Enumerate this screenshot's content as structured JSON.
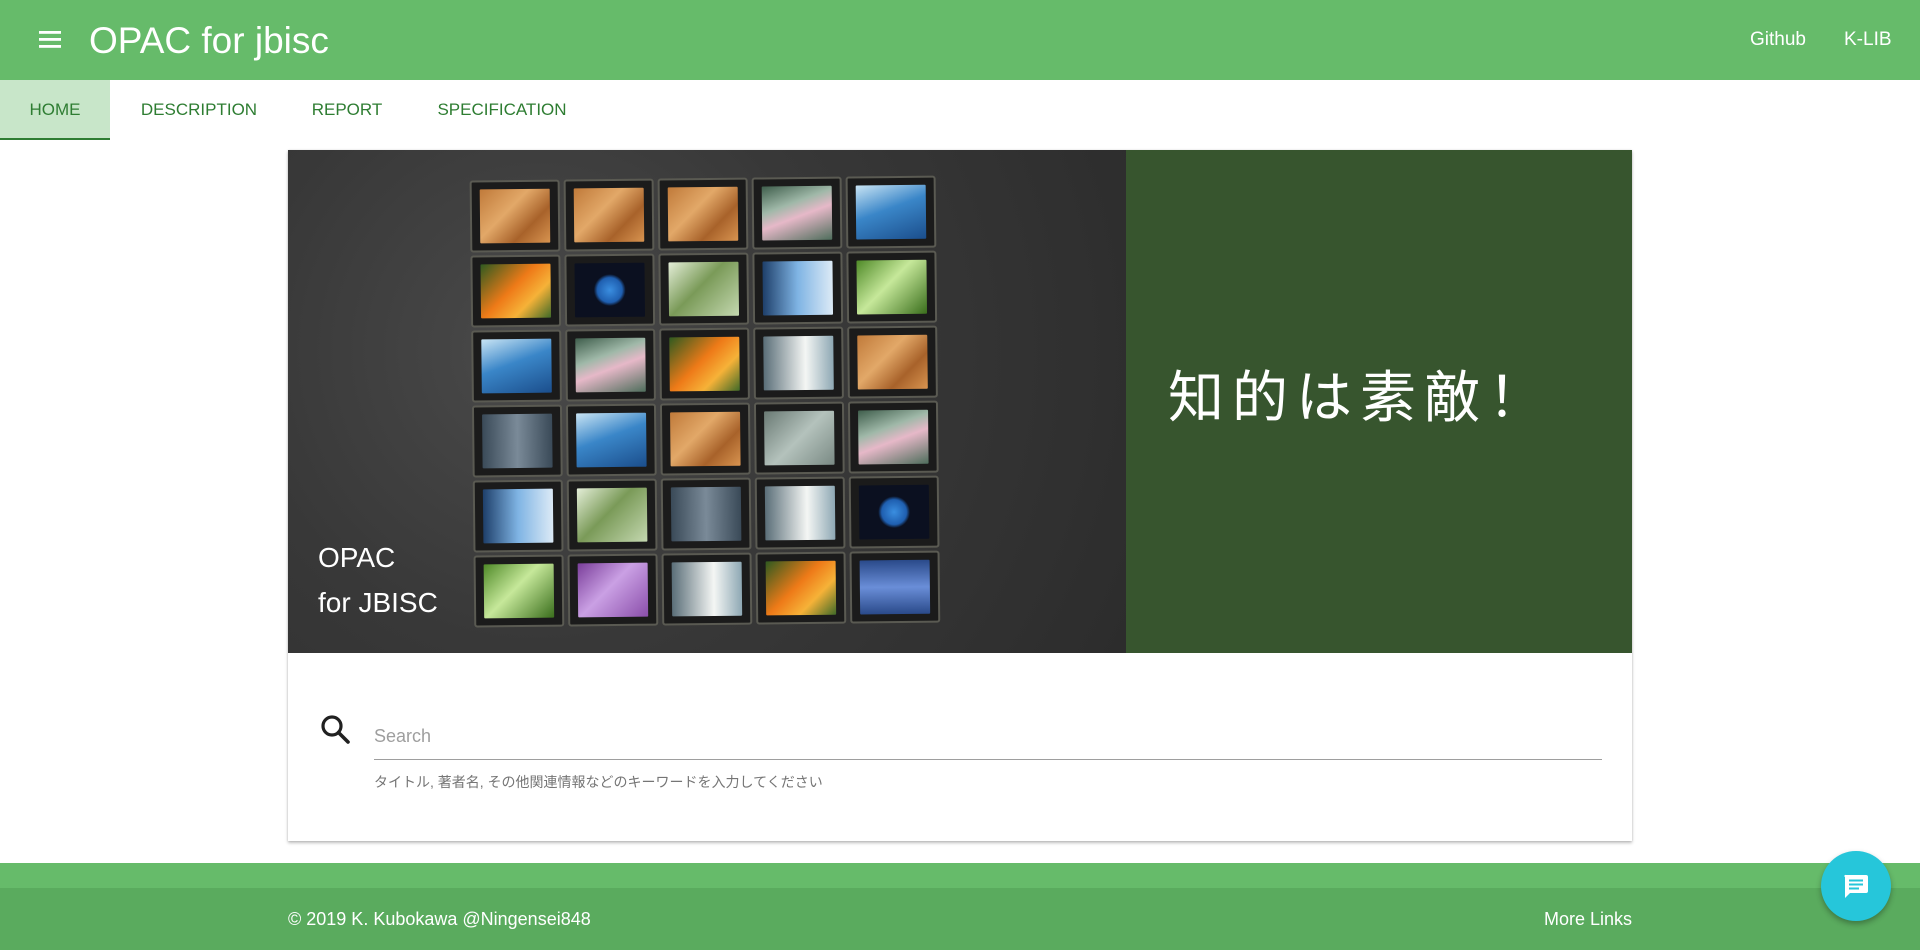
{
  "header": {
    "title": "OPAC for jbisc",
    "links": [
      "Github",
      "K-LIB"
    ],
    "menu_icon": "menu-icon"
  },
  "tabs": [
    {
      "label": "HOME",
      "active": true
    },
    {
      "label": "DESCRIPTION",
      "active": false
    },
    {
      "label": "REPORT",
      "active": false
    },
    {
      "label": "SPECIFICATION",
      "active": false
    }
  ],
  "hero": {
    "caption_line1": "OPAC",
    "caption_line2": "for JBISC",
    "slogan": "知的は素敵！"
  },
  "search": {
    "placeholder": "Search",
    "value": "",
    "helper": "タイトル, 著者名, その他関連情報などのキーワードを入力してください",
    "icon": "search-icon"
  },
  "footer": {
    "copyright": "© 2019 K. Kubokawa @Ningensei848",
    "more_links": "More Links"
  },
  "fab": {
    "icon": "chat-icon"
  },
  "colors": {
    "app_bar": "#66bb6a",
    "tab_text": "#2e7d32",
    "tab_active_bg": "#c8e6c9",
    "hero_panel": "#37552e",
    "footer": "#5aab5e",
    "fab": "#26c6da"
  }
}
